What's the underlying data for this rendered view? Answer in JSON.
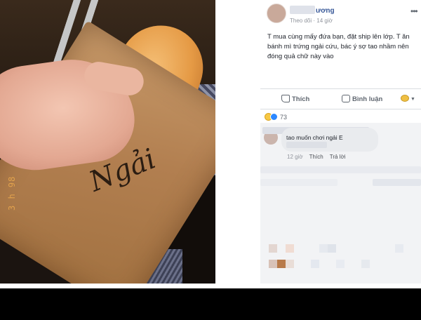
{
  "post": {
    "author_name_visible": "ương",
    "follow_label": "Theo dõi",
    "time": "14 giờ",
    "text": "T mua cùng mấy đứa bạn, đặt ship lên lớp. T ăn bánh mì trứng ngải cứu, bác ý sợ tao nhầm nên đóng quả chữ này vào",
    "more_icon": "more-dots-icon"
  },
  "photo": {
    "handwritten_word": "Ngải",
    "date_stamp": "3 h 98"
  },
  "actions": {
    "like_label": "Thích",
    "comment_label": "Bình luận"
  },
  "reactions": {
    "types": [
      "haha",
      "like"
    ],
    "count": "73"
  },
  "comment": {
    "text_visible": "tao muốn chơi ngải E",
    "time": "12 giờ",
    "like_label": "Thích",
    "reply_label": "Trả lời"
  },
  "colors": {
    "link_blue": "#385898",
    "like_blue": "#2d88ff",
    "muted_text": "#90949c",
    "band": "#000000"
  }
}
